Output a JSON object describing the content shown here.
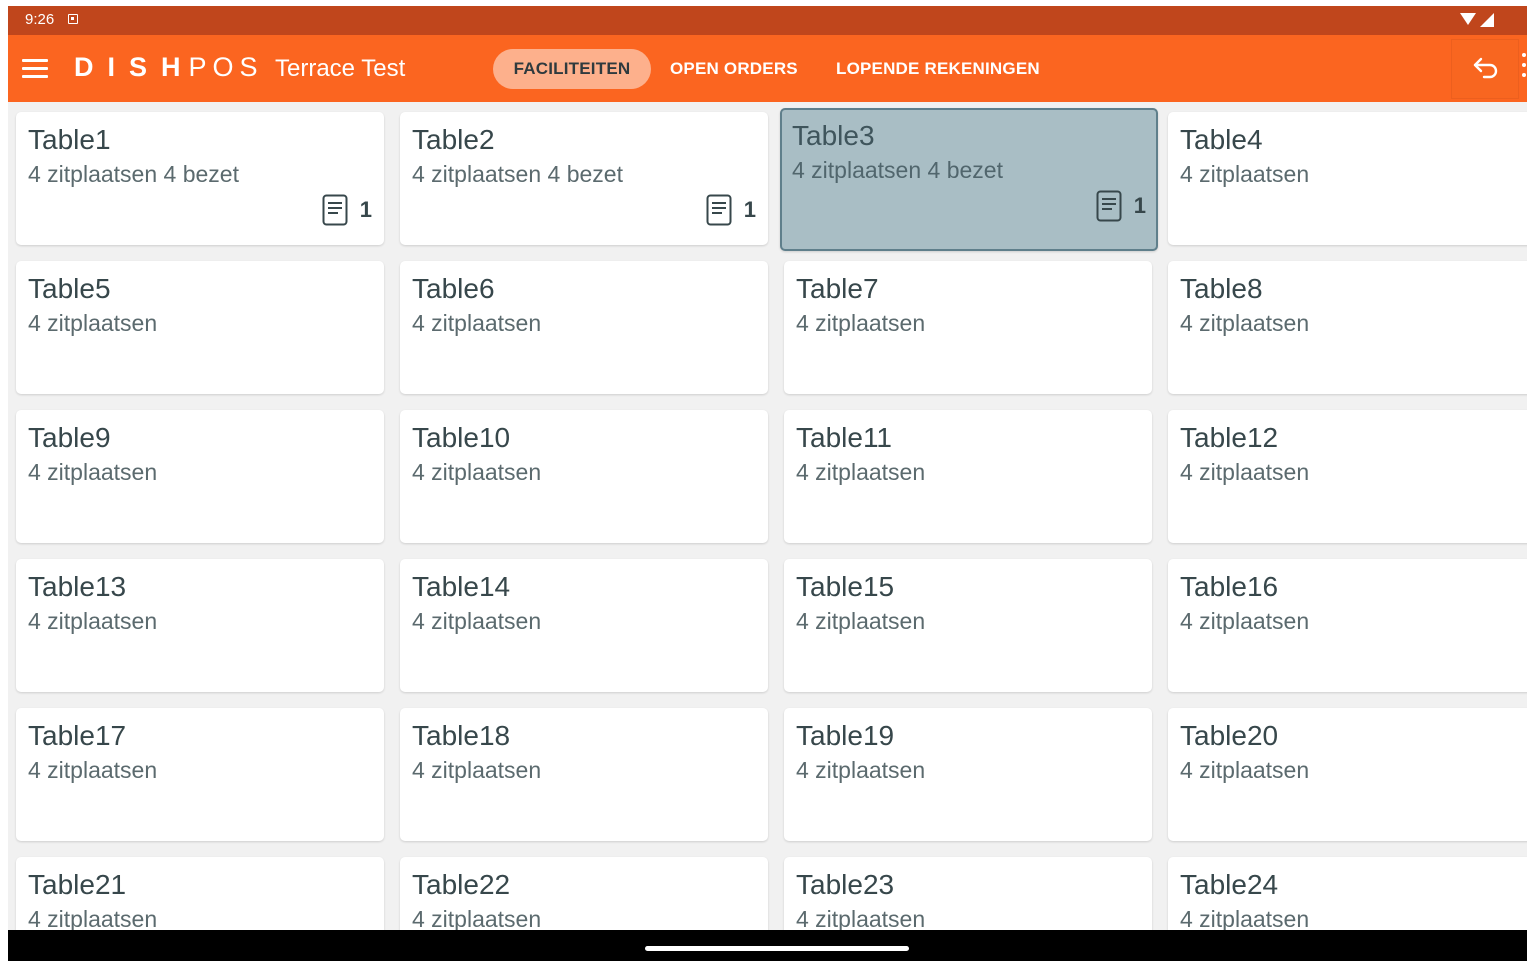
{
  "status": {
    "time": "9:26"
  },
  "header": {
    "logo_bold": "DISH",
    "logo_light": "POS",
    "facility": "Terrace Test",
    "tabs": [
      {
        "label": "FACILITEITEN",
        "active": true
      },
      {
        "label": "OPEN ORDERS",
        "active": false
      },
      {
        "label": "LOPENDE REKENINGEN",
        "active": false
      }
    ]
  },
  "tables": [
    {
      "name": "Table1",
      "seats": "4 zitplaatsen 4 bezet",
      "orders": "1"
    },
    {
      "name": "Table2",
      "seats": "4 zitplaatsen 4 bezet",
      "orders": "1"
    },
    {
      "name": "Table3",
      "seats": "4 zitplaatsen 4 bezet",
      "orders": "1",
      "selected": true
    },
    {
      "name": "Table4",
      "seats": "4 zitplaatsen"
    },
    {
      "name": "Table5",
      "seats": "4 zitplaatsen"
    },
    {
      "name": "Table6",
      "seats": "4 zitplaatsen"
    },
    {
      "name": "Table7",
      "seats": "4 zitplaatsen"
    },
    {
      "name": "Table8",
      "seats": "4 zitplaatsen"
    },
    {
      "name": "Table9",
      "seats": "4 zitplaatsen"
    },
    {
      "name": "Table10",
      "seats": "4 zitplaatsen"
    },
    {
      "name": "Table11",
      "seats": "4 zitplaatsen"
    },
    {
      "name": "Table12",
      "seats": "4 zitplaatsen"
    },
    {
      "name": "Table13",
      "seats": "4 zitplaatsen"
    },
    {
      "name": "Table14",
      "seats": "4 zitplaatsen"
    },
    {
      "name": "Table15",
      "seats": "4 zitplaatsen"
    },
    {
      "name": "Table16",
      "seats": "4 zitplaatsen"
    },
    {
      "name": "Table17",
      "seats": "4 zitplaatsen"
    },
    {
      "name": "Table18",
      "seats": "4 zitplaatsen"
    },
    {
      "name": "Table19",
      "seats": "4 zitplaatsen"
    },
    {
      "name": "Table20",
      "seats": "4 zitplaatsen"
    },
    {
      "name": "Table21",
      "seats": "4 zitplaatsen"
    },
    {
      "name": "Table22",
      "seats": "4 zitplaatsen"
    },
    {
      "name": "Table23",
      "seats": "4 zitplaatsen"
    },
    {
      "name": "Table24",
      "seats": "4 zitplaatsen"
    }
  ],
  "icons": {
    "menu": "hamburger-menu-icon",
    "back": "return-arrow-icon",
    "order": "receipt-icon",
    "overflow": "more-vert-icon"
  },
  "colors": {
    "status_bar": "#c0461c",
    "app_bar": "#fb6520",
    "active_tab": "#fdb08c",
    "selected_card": "#a9bec5"
  }
}
